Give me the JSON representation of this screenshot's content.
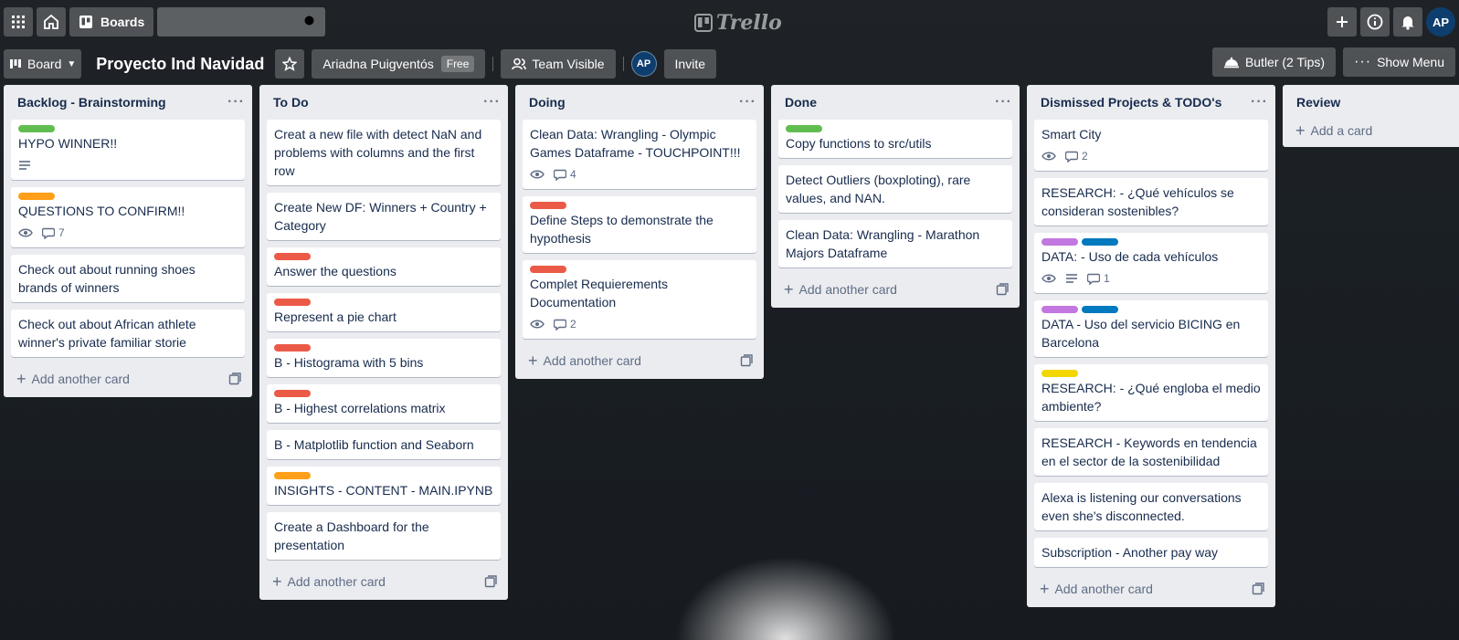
{
  "topbar": {
    "boards_label": "Boards",
    "search_value": "",
    "logo_text": "Trello",
    "user_initials": "AP"
  },
  "boardbar": {
    "view_label": "Board",
    "title": "Proyecto Ind Navidad",
    "workspace_name": "Ariadna Puigventós",
    "workspace_badge": "Free",
    "visibility_label": "Team Visible",
    "member_initials": "AP",
    "invite_label": "Invite",
    "butler_label": "Butler (2 Tips)",
    "menu_label": "Show Menu"
  },
  "colors": {
    "green": "#61bd4f",
    "orange": "#ff9f1a",
    "red": "#eb5a46",
    "purple": "#c377e0",
    "blue": "#0079bf",
    "yellow": "#f2d600"
  },
  "lists": [
    {
      "title": "Backlog - Brainstorming",
      "add_label": "Add another card",
      "cards": [
        {
          "labels": [
            "green"
          ],
          "title": "HYPO WINNER!!",
          "badges": {
            "description": true
          }
        },
        {
          "labels": [
            "orange"
          ],
          "title": "QUESTIONS TO CONFIRM!!",
          "badges": {
            "watch": true,
            "comments": "7"
          }
        },
        {
          "labels": [],
          "title": "Check out about running shoes brands of winners"
        },
        {
          "labels": [],
          "title": "Check out about African athlete winner's private familiar storie"
        }
      ]
    },
    {
      "title": "To Do",
      "add_label": "Add another card",
      "cards": [
        {
          "labels": [],
          "title": "Creat a new file with detect NaN and problems with columns and the first row"
        },
        {
          "labels": [],
          "title": "Create New DF: Winners + Country + Category"
        },
        {
          "labels": [
            "red"
          ],
          "title": "Answer the questions"
        },
        {
          "labels": [
            "red"
          ],
          "title": "Represent a pie chart"
        },
        {
          "labels": [
            "red"
          ],
          "title": "B - Histograma with 5 bins"
        },
        {
          "labels": [
            "red"
          ],
          "title": "B - Highest correlations matrix"
        },
        {
          "labels": [],
          "title": "B - Matplotlib function and Seaborn"
        },
        {
          "labels": [
            "orange"
          ],
          "title": "INSIGHTS - CONTENT - MAIN.IPYNB"
        },
        {
          "labels": [],
          "title": "Create a Dashboard for the presentation"
        }
      ]
    },
    {
      "title": "Doing",
      "add_label": "Add another card",
      "cards": [
        {
          "labels": [],
          "title": "Clean Data: Wrangling - Olympic Games Dataframe - TOUCHPOINT!!!",
          "badges": {
            "watch": true,
            "comments": "4"
          }
        },
        {
          "labels": [
            "red"
          ],
          "title": "Define Steps to demonstrate the hypothesis"
        },
        {
          "labels": [
            "red"
          ],
          "title": "Complet Requierements Documentation",
          "badges": {
            "watch": true,
            "comments": "2"
          }
        }
      ]
    },
    {
      "title": "Done",
      "add_label": "Add another card",
      "cards": [
        {
          "labels": [
            "green"
          ],
          "title": "Copy functions to src/utils"
        },
        {
          "labels": [],
          "title": "Detect Outliers (boxploting), rare values, and NAN."
        },
        {
          "labels": [],
          "title": "Clean Data: Wrangling - Marathon Majors Dataframe"
        }
      ]
    },
    {
      "title": "Dismissed Projects & TODO's",
      "add_label": "Add another card",
      "cards": [
        {
          "labels": [],
          "title": "Smart City",
          "badges": {
            "watch": true,
            "comments": "2"
          }
        },
        {
          "labels": [],
          "title": "RESEARCH: - ¿Qué vehículos se consideran sostenibles?"
        },
        {
          "labels": [
            "purple",
            "blue"
          ],
          "title": "DATA: - Uso de cada vehículos",
          "badges": {
            "watch": true,
            "description": true,
            "comments": "1"
          }
        },
        {
          "labels": [
            "purple",
            "blue"
          ],
          "title": "DATA - Uso del servicio BICING en Barcelona"
        },
        {
          "labels": [
            "yellow"
          ],
          "title": "RESEARCH: - ¿Qué engloba el medio ambiente?"
        },
        {
          "labels": [],
          "title": "RESEARCH - Keywords en tendencia en el sector de la sostenibilidad"
        },
        {
          "labels": [],
          "title": "Alexa is listening our conversations even she's disconnected."
        },
        {
          "labels": [],
          "title": "Subscription - Another pay way"
        }
      ]
    },
    {
      "title": "Review",
      "add_label": "Add a card",
      "cards": []
    }
  ]
}
